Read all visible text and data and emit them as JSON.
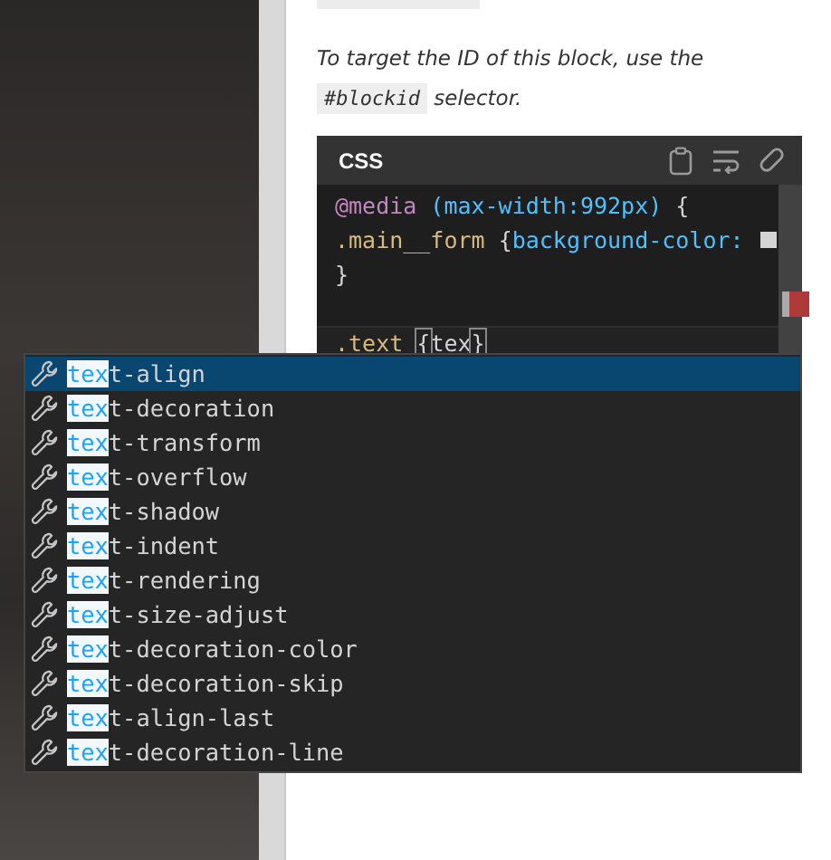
{
  "help": {
    "before": "To target the ID of this block, use the",
    "code": "#blockid",
    "after": "selector."
  },
  "editor": {
    "language": "CSS",
    "lines": [
      {
        "current": false,
        "tokens": [
          {
            "kind": "at",
            "text": "@media"
          },
          {
            "kind": "value",
            "text": " (max-width:992px)"
          },
          {
            "kind": "plain",
            "text": " {"
          }
        ]
      },
      {
        "current": false,
        "tokens": [
          {
            "kind": "selector",
            "text": ".main__form "
          },
          {
            "kind": "plain",
            "text": "{"
          },
          {
            "kind": "value",
            "text": "background-color: "
          },
          {
            "kind": "swatch"
          }
        ]
      },
      {
        "current": false,
        "tokens": [
          {
            "kind": "plain",
            "text": "}"
          }
        ]
      },
      {
        "current": true,
        "tokens": [
          {
            "kind": "selector",
            "text": ".text "
          },
          {
            "kind": "bracket",
            "text": "{"
          },
          {
            "kind": "plain",
            "text": "tex"
          },
          {
            "kind": "bracket",
            "text": "}"
          }
        ]
      }
    ]
  },
  "suggestions": [
    {
      "match": "tex",
      "rest": "t-align",
      "selected": true
    },
    {
      "match": "tex",
      "rest": "t-decoration",
      "selected": false
    },
    {
      "match": "tex",
      "rest": "t-transform",
      "selected": false
    },
    {
      "match": "tex",
      "rest": "t-overflow",
      "selected": false
    },
    {
      "match": "tex",
      "rest": "t-shadow",
      "selected": false
    },
    {
      "match": "tex",
      "rest": "t-indent",
      "selected": false
    },
    {
      "match": "tex",
      "rest": "t-rendering",
      "selected": false
    },
    {
      "match": "tex",
      "rest": "t-size-adjust",
      "selected": false
    },
    {
      "match": "tex",
      "rest": "t-decoration-color",
      "selected": false
    },
    {
      "match": "tex",
      "rest": "t-decoration-skip",
      "selected": false
    },
    {
      "match": "tex",
      "rest": "t-align-last",
      "selected": false
    },
    {
      "match": "tex",
      "rest": "t-decoration-line",
      "selected": false
    }
  ]
}
